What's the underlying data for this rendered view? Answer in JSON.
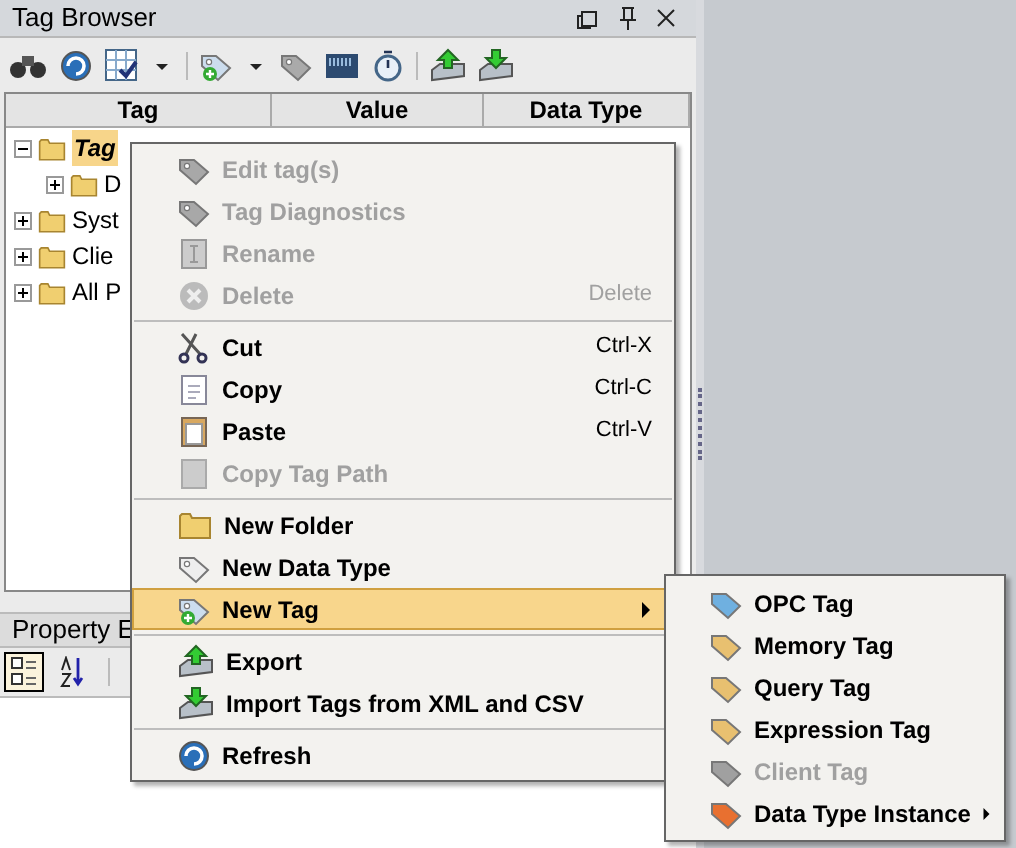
{
  "tag_browser": {
    "title": "Tag Browser",
    "columns": [
      "Tag",
      "Value",
      "Data Type"
    ],
    "tree": [
      {
        "label": "Tag",
        "selected": true,
        "expanded": true,
        "children": [
          {
            "label": "D",
            "selected": false,
            "expanded": false
          }
        ]
      },
      {
        "label": "Syst",
        "selected": false,
        "expanded": false
      },
      {
        "label": "Clie",
        "selected": false,
        "expanded": false
      },
      {
        "label": "All P",
        "selected": false,
        "expanded": false
      }
    ]
  },
  "property_editor": {
    "title": "Property E",
    "sort_buttons": [
      {
        "selected": true
      },
      {
        "selected": false
      }
    ]
  },
  "context_menu": [
    {
      "kind": "item",
      "label": "Edit tag(s)",
      "disabled": true
    },
    {
      "kind": "item",
      "label": "Tag Diagnostics",
      "disabled": true
    },
    {
      "kind": "item",
      "label": "Rename",
      "disabled": true
    },
    {
      "kind": "item",
      "label": "Delete",
      "disabled": true,
      "shortcut": "Delete"
    },
    {
      "kind": "separator"
    },
    {
      "kind": "item",
      "label": "Cut",
      "disabled": false,
      "shortcut": "Ctrl-X"
    },
    {
      "kind": "item",
      "label": "Copy",
      "disabled": false,
      "shortcut": "Ctrl-C"
    },
    {
      "kind": "item",
      "label": "Paste",
      "disabled": false,
      "shortcut": "Ctrl-V"
    },
    {
      "kind": "item",
      "label": "Copy Tag Path",
      "disabled": true
    },
    {
      "kind": "separator"
    },
    {
      "kind": "item",
      "label": "New Folder",
      "disabled": false
    },
    {
      "kind": "item",
      "label": "New Data Type",
      "disabled": false
    },
    {
      "kind": "item",
      "label": "New Tag",
      "disabled": false,
      "selected": true,
      "submenu": true
    },
    {
      "kind": "separator"
    },
    {
      "kind": "item",
      "label": "Export",
      "disabled": false
    },
    {
      "kind": "item",
      "label": "Import Tags from XML and CSV",
      "disabled": false
    },
    {
      "kind": "separator"
    },
    {
      "kind": "item",
      "label": "Refresh",
      "disabled": false
    }
  ],
  "submenu": [
    {
      "label": "OPC Tag",
      "disabled": false,
      "color": "#6fb0e0"
    },
    {
      "label": "Memory Tag",
      "disabled": false,
      "color": "#e8c070"
    },
    {
      "label": "Query Tag",
      "disabled": false,
      "color": "#e8c070"
    },
    {
      "label": "Expression Tag",
      "disabled": false,
      "color": "#e8c070"
    },
    {
      "label": "Client Tag",
      "disabled": true,
      "color": "#a0a0a0"
    },
    {
      "label": "Data Type Instance",
      "disabled": false,
      "color": "#e87030",
      "submenu": true
    }
  ]
}
